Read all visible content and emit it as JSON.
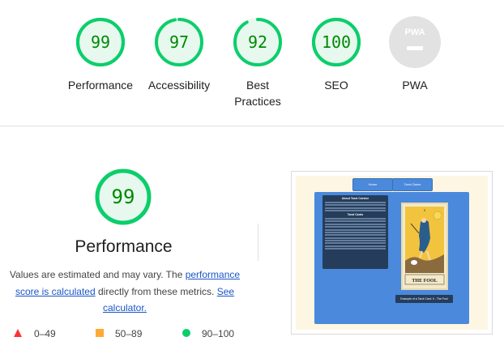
{
  "categories": [
    {
      "label": "Performance",
      "score": "99",
      "value": 99,
      "color": "#0cce6b"
    },
    {
      "label": "Accessibility",
      "score": "97",
      "value": 97,
      "color": "#0cce6b"
    },
    {
      "label": "Best Practices",
      "label_line1": "Best",
      "label_line2": "Practices",
      "score": "92",
      "value": 92,
      "color": "#0cce6b"
    },
    {
      "label": "SEO",
      "score": "100",
      "value": 100,
      "color": "#0cce6b"
    },
    {
      "label": "PWA",
      "badge": "PWA"
    }
  ],
  "performance": {
    "score": "99",
    "value": 99,
    "title": "Performance",
    "desc_prefix": "Values are estimated and may vary. The ",
    "desc_link1": "performance score is calculated",
    "desc_middle": " directly from these metrics. ",
    "desc_link2": "See calculator."
  },
  "legend": [
    {
      "range": "0–49",
      "color": "#ff3333",
      "shape": "triangle"
    },
    {
      "range": "50–89",
      "color": "#ffaa33",
      "shape": "square"
    },
    {
      "range": "90–100",
      "color": "#0cce6b",
      "shape": "circle"
    }
  ],
  "screenshot": {
    "nav_home": "Home",
    "nav_tarot": "Tarot Game",
    "text_title": "About Tarot Cursive",
    "text_subtitle": "Tarot Cards",
    "card_title": "THE FOOL",
    "card_number": "0",
    "caption": "Example of a Tarot Card: 0 - The Fool"
  }
}
